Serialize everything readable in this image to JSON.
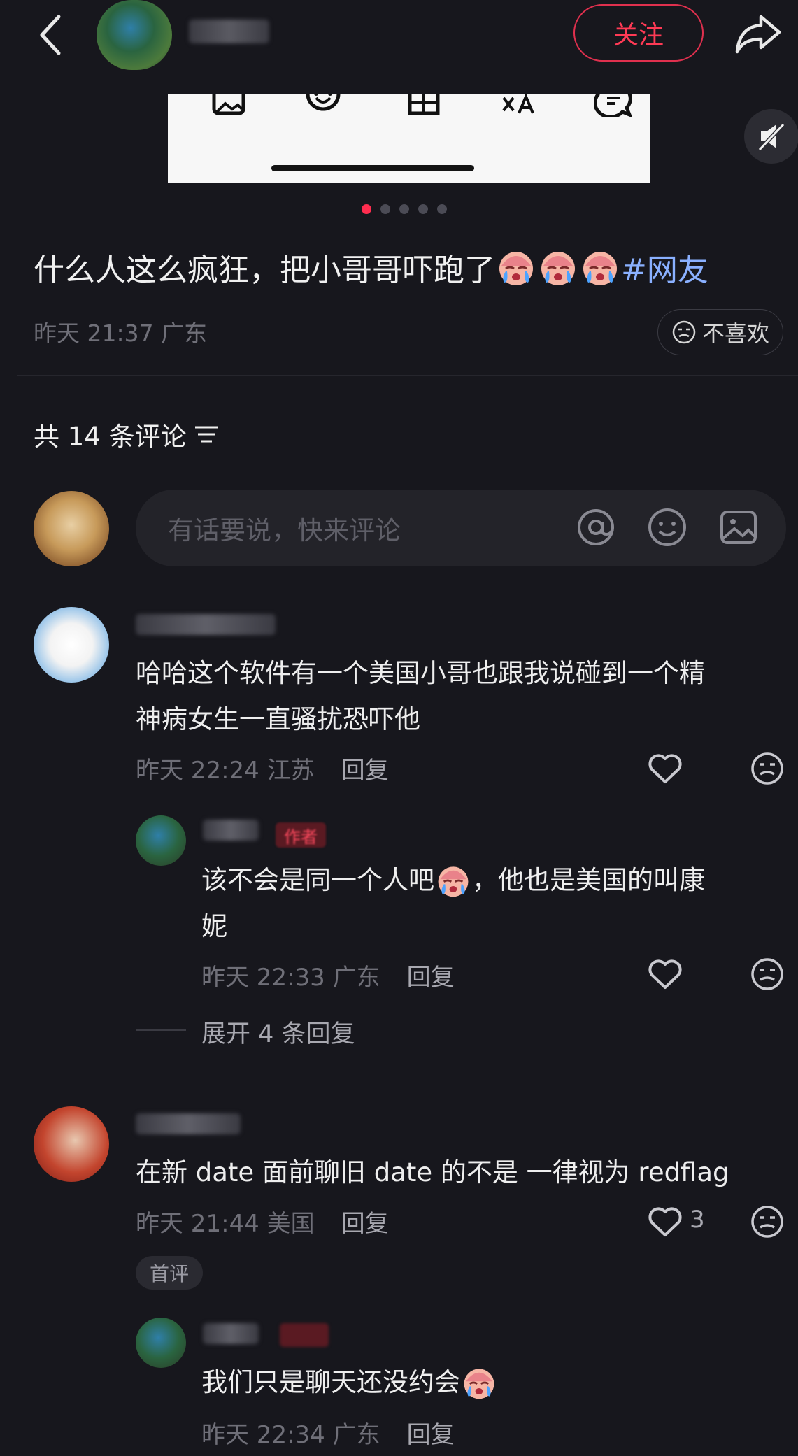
{
  "header": {
    "follow_label": "关注"
  },
  "post": {
    "caption": "什么人这么疯狂，把小哥哥吓跑了",
    "hashtag": "#网友",
    "time": "昨天 21:37",
    "location": "广东",
    "dislike_label": "不喜欢",
    "page_count": 5,
    "active_page": 1
  },
  "comments_header": {
    "count_label": "共 14 条评论"
  },
  "comment_input": {
    "placeholder": "有话要说，快来评论"
  },
  "comments": [
    {
      "text_line1": "哈哈这个软件有一个美国小哥也跟我说碰到一个精",
      "text_line2": "神病女生一直骚扰恐吓他",
      "time": "昨天 22:24",
      "location": "江苏",
      "reply_label": "回复"
    },
    {
      "tag": "作者",
      "text_line1a": "该不会是同一个人吧",
      "text_line1b": "，他也是美国的叫康",
      "text_line2": "妮",
      "time": "昨天 22:33",
      "location": "广东",
      "reply_label": "回复"
    },
    {
      "text": "在新 date 面前聊旧 date 的不是 一律视为 redflag",
      "time": "昨天 21:44",
      "location": "美国",
      "reply_label": "回复",
      "likes": "3",
      "badge": "首评"
    },
    {
      "text": "我们只是聊天还没约会",
      "time": "昨天 22:34",
      "location": "广东",
      "reply_label": "回复"
    }
  ],
  "expand_replies_label": "展开 4 条回复",
  "colors": {
    "background": "#17171d",
    "accent": "#ff2d4f",
    "hashtag": "#8ab0ff"
  }
}
